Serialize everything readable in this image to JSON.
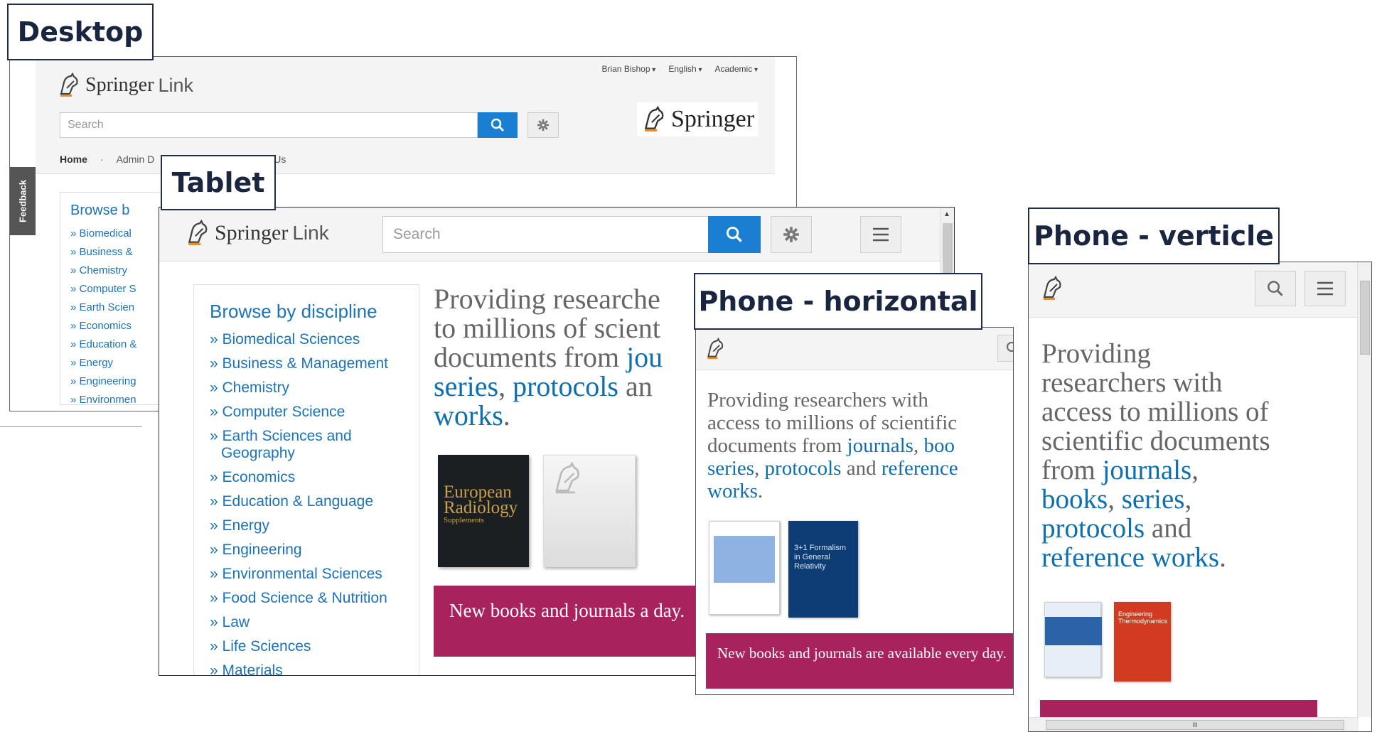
{
  "labels": {
    "desktop": "Desktop",
    "tablet": "Tablet",
    "phone_horizontal": "Phone - horizontal",
    "phone_vertical": "Phone - verticle"
  },
  "brand": {
    "springer": "Springer",
    "link": "Link"
  },
  "desktop": {
    "top_links": [
      "Brian Bishop",
      "English",
      "Academic"
    ],
    "search_placeholder": "Search",
    "nav_home": "Home",
    "nav_sep": "·",
    "nav_admin": "Admin D",
    "nav_us": "Us",
    "feedback": "Feedback",
    "browse_title": "Browse b",
    "browse_items": [
      "» Biomedical",
      "» Business &",
      "» Chemistry",
      "» Computer S",
      "» Earth Scien",
      "» Economics",
      "» Education &",
      "» Energy",
      "» Engineering",
      "» Environmen"
    ]
  },
  "tablet": {
    "search_placeholder": "Search",
    "browse_title": "Browse by discipline",
    "browse_items": [
      "» Biomedical Sciences",
      "» Business & Management",
      "» Chemistry",
      "» Computer Science",
      "» Earth Sciences and Geography",
      "» Economics",
      "» Education & Language",
      "» Energy",
      "» Engineering",
      "» Environmental Sciences",
      "» Food Science & Nutrition",
      "» Law",
      "» Life Sciences",
      "» Materials"
    ],
    "tagline_l1": "Providing researche",
    "tagline_l2": "to millions of scient",
    "tagline_l3a": "documents from ",
    "tagline_l3b": "jou",
    "tagline_l4a": "series",
    "tagline_l4b": ", ",
    "tagline_l4c": "protocols",
    "tagline_l4d": " an",
    "tagline_l5a": "works",
    "tagline_l5b": ".",
    "cover_title": "European Radiology",
    "cover_sub": "Supplements",
    "banner": "New books and journals a day."
  },
  "phone_horizontal": {
    "tagline_l1": "Providing researchers with",
    "tagline_l2": "access to millions of scientific",
    "tagline_l3a": "documents from ",
    "tagline_l3b": "journals",
    "tagline_l3c": ", ",
    "tagline_l3d": "boo",
    "tagline_l4a": "series",
    "tagline_l4b": ", ",
    "tagline_l4c": "protocols",
    "tagline_l4d": " and ",
    "tagline_l4e": "reference",
    "tagline_l5a": "works",
    "tagline_l5b": ".",
    "cover_b_text": "3+1 Formalism in General Relativity",
    "banner": "New books and journals are available every day."
  },
  "phone_vertical": {
    "tagline_l1": "Providing",
    "tagline_l2": "researchers with",
    "tagline_l3": "access to millions of",
    "tagline_l4": "scientific documents",
    "tagline_l5a": "from ",
    "tagline_l5b": "journals",
    "tagline_l5c": ",",
    "tagline_l6a": "books",
    "tagline_l6b": ", ",
    "tagline_l6c": "series",
    "tagline_l6d": ",",
    "tagline_l7a": "protocols",
    "tagline_l7b": " and",
    "tagline_l8a": "reference works",
    "tagline_l8b": ".",
    "cover_b_text": "Engineering Thermodynamics",
    "scroll_grip": "III"
  },
  "colors": {
    "accent_blue": "#1a7fd0",
    "link_blue": "#0e6fb0",
    "banner_magenta": "#a8235e",
    "logo_orange": "#f08a24"
  },
  "icons": [
    "springer-horse-icon",
    "search-icon",
    "gear-icon",
    "menu-icon",
    "magnifier-icon",
    "scroll-up-icon"
  ]
}
